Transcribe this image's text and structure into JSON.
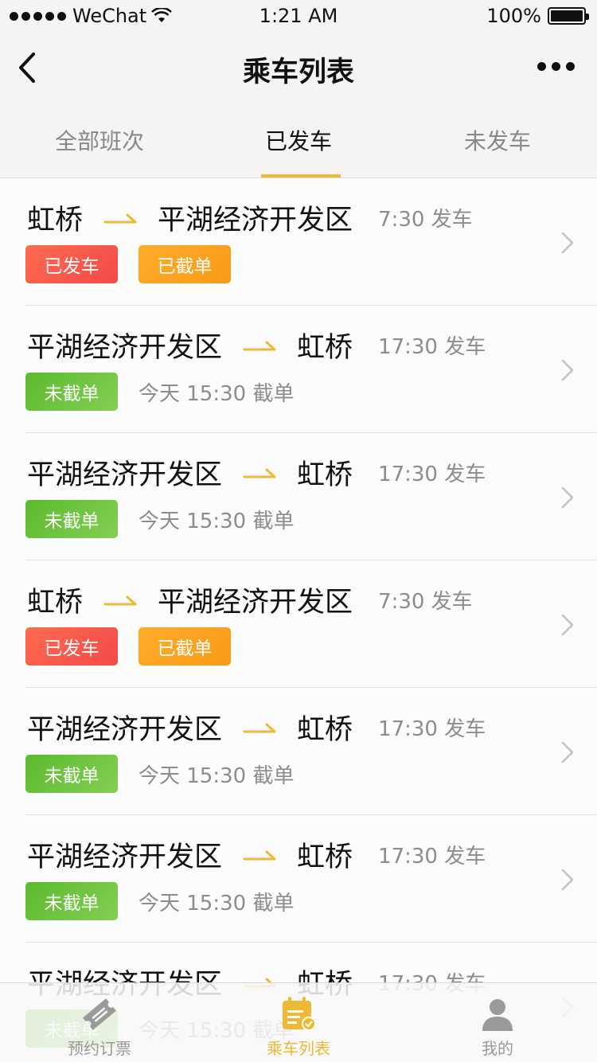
{
  "status_bar": {
    "carrier": "WeChat",
    "time": "1:21 AM",
    "battery": "100%"
  },
  "nav": {
    "title": "乘车列表"
  },
  "tabs": [
    {
      "label": "全部班次",
      "active": false
    },
    {
      "label": "已发车",
      "active": true
    },
    {
      "label": "未发车",
      "active": false
    }
  ],
  "trips": [
    {
      "from": "虹桥",
      "to": "平湖经济开发区",
      "depart": "7:30 发车",
      "badges": [
        "已发车",
        "已截单"
      ],
      "cutoff": ""
    },
    {
      "from": "平湖经济开发区",
      "to": "虹桥",
      "depart": "17:30 发车",
      "badges": [
        "未截单"
      ],
      "cutoff": "今天 15:30 截单"
    },
    {
      "from": "平湖经济开发区",
      "to": "虹桥",
      "depart": "17:30 发车",
      "badges": [
        "未截单"
      ],
      "cutoff": "今天 15:30 截单"
    },
    {
      "from": "虹桥",
      "to": "平湖经济开发区",
      "depart": "7:30 发车",
      "badges": [
        "已发车",
        "已截单"
      ],
      "cutoff": ""
    },
    {
      "from": "平湖经济开发区",
      "to": "虹桥",
      "depart": "17:30 发车",
      "badges": [
        "未截单"
      ],
      "cutoff": "今天 15:30 截单"
    },
    {
      "from": "平湖经济开发区",
      "to": "虹桥",
      "depart": "17:30 发车",
      "badges": [
        "未截单"
      ],
      "cutoff": "今天 15:30 截单"
    },
    {
      "from": "平湖经济开发区",
      "to": "虹桥",
      "depart": "17:30 发车",
      "badges": [
        "未截单"
      ],
      "cutoff": "今天 15:30 截单"
    }
  ],
  "tabbar": [
    {
      "label": "预约订票",
      "icon": "ticket-icon",
      "active": false
    },
    {
      "label": "乘车列表",
      "icon": "calendar-check-icon",
      "active": true
    },
    {
      "label": "我的",
      "icon": "user-icon",
      "active": false
    }
  ],
  "colors": {
    "accent": "#f0b935",
    "departed": "#f24a4a",
    "closed": "#f89a16",
    "open": "#5cba2c"
  }
}
